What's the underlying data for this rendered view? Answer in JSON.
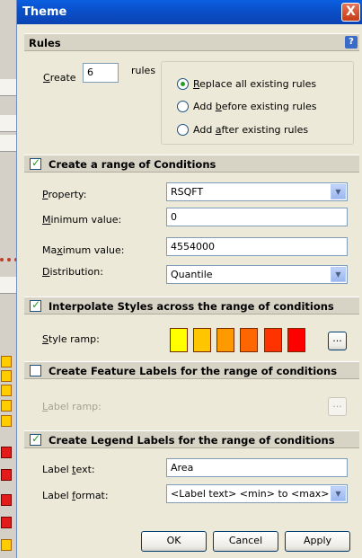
{
  "dialog": {
    "title": "Theme",
    "close_glyph": "X"
  },
  "rules": {
    "header": "Rules",
    "help_glyph": "?",
    "create_label": "Create",
    "count": "6",
    "rules_label": "rules",
    "options": [
      {
        "label": "Replace all existing rules",
        "selected": true
      },
      {
        "label": "Add before existing rules",
        "selected": false
      },
      {
        "label": "Add after existing rules",
        "selected": false
      }
    ]
  },
  "conditions": {
    "header": "Create a range of Conditions",
    "checked": true,
    "property_label": "Property:",
    "property_value": "RSQFT",
    "min_label": "Minimum value:",
    "min_value": "0",
    "max_label": "Maximum value:",
    "max_value": "4554000",
    "distribution_label": "Distribution:",
    "distribution_value": "Quantile"
  },
  "styles": {
    "header": "Interpolate Styles across the range of conditions",
    "checked": true,
    "ramp_label": "Style ramp:",
    "ramp_colors": [
      "#ffff00",
      "#ffc600",
      "#ff9900",
      "#ff6600",
      "#ff3300",
      "#ff0000"
    ],
    "more_button": "..."
  },
  "feature_labels": {
    "header": "Create Feature Labels for the range of conditions",
    "checked": false,
    "ramp_label": "Label ramp:",
    "more_button": "..."
  },
  "legend": {
    "header": "Create Legend Labels for the range of conditions",
    "checked": true,
    "text_label": "Label text:",
    "text_value": "Area",
    "format_label": "Label format:",
    "format_value": "<Label text> <min> to <max>"
  },
  "buttons": {
    "ok": "OK",
    "cancel": "Cancel",
    "apply": "Apply"
  }
}
